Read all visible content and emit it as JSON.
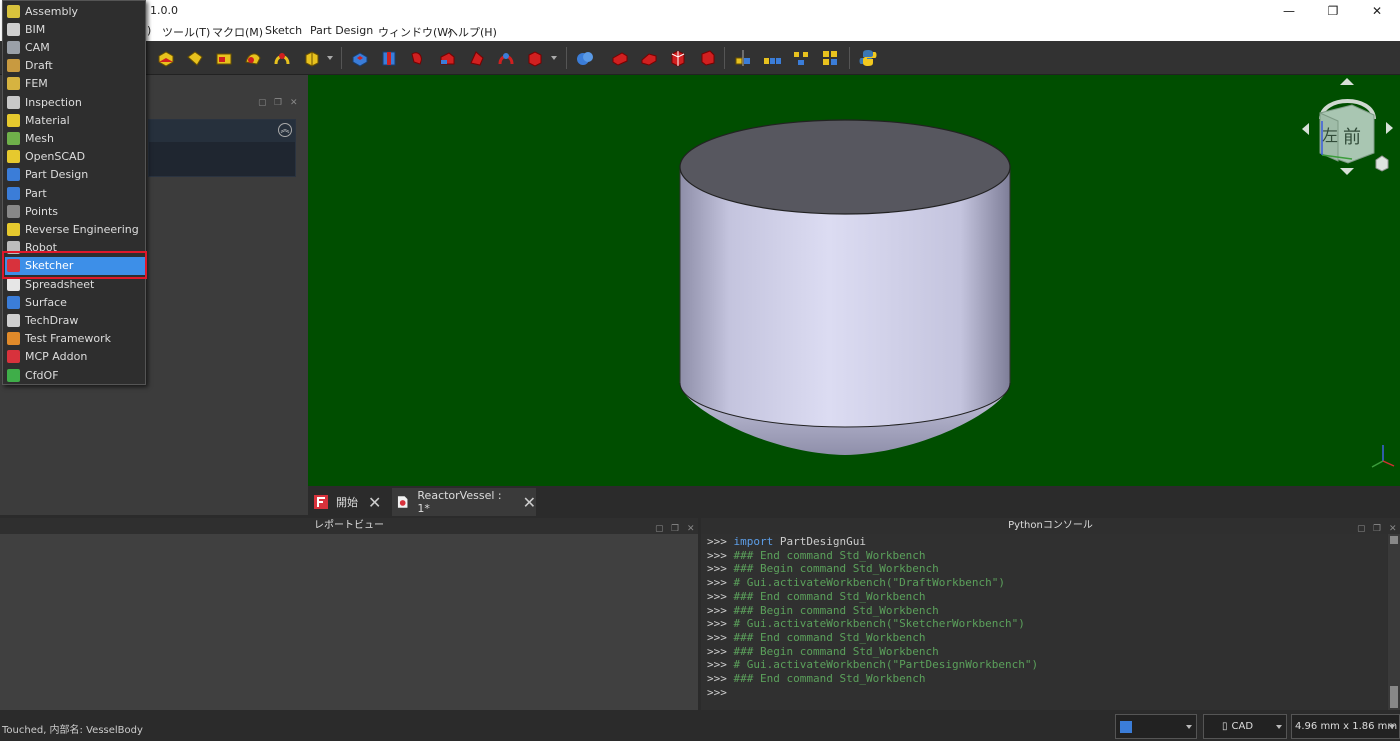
{
  "window": {
    "title": "1.0.0",
    "minimize_glyph": "—",
    "maximize_glyph": "❐",
    "close_glyph": "✕"
  },
  "menubar": {
    "items": [
      "ツール(T)",
      "マクロ(M)",
      "Sketch",
      "Part Design",
      "ウィンドウ(W)",
      "ヘルプ(H)"
    ],
    "fragment": ")"
  },
  "workbench_menu": {
    "items": [
      {
        "label": "Assembly",
        "icon": "assembly-icon",
        "color": "#d8c23c"
      },
      {
        "label": "BIM",
        "icon": "bim-icon",
        "color": "#cfcfcf"
      },
      {
        "label": "CAM",
        "icon": "cam-icon",
        "color": "#9aa0a8"
      },
      {
        "label": "Draft",
        "icon": "draft-icon",
        "color": "#c89a40"
      },
      {
        "label": "FEM",
        "icon": "fem-icon",
        "color": "#d6b340"
      },
      {
        "label": "Inspection",
        "icon": "inspection-icon",
        "color": "#c8c8c8"
      },
      {
        "label": "Material",
        "icon": "material-icon",
        "color": "#e6c92e"
      },
      {
        "label": "Mesh",
        "icon": "mesh-icon",
        "color": "#6fb04a"
      },
      {
        "label": "OpenSCAD",
        "icon": "openscad-icon",
        "color": "#e6c92e"
      },
      {
        "label": "Part Design",
        "icon": "part-design-icon",
        "color": "#3b7dd8"
      },
      {
        "label": "Part",
        "icon": "part-icon",
        "color": "#3b7dd8"
      },
      {
        "label": "Points",
        "icon": "points-icon",
        "color": "#888888"
      },
      {
        "label": "Reverse Engineering",
        "icon": "reverse-engineering-icon",
        "color": "#e6c92e"
      },
      {
        "label": "Robot",
        "icon": "robot-icon",
        "color": "#bdbdbd"
      },
      {
        "label": "Sketcher",
        "icon": "sketcher-icon",
        "color": "#d8323c",
        "selected": true
      },
      {
        "label": "Spreadsheet",
        "icon": "spreadsheet-icon",
        "color": "#e6e6e6"
      },
      {
        "label": "Surface",
        "icon": "surface-icon",
        "color": "#3b7dd8"
      },
      {
        "label": "TechDraw",
        "icon": "techdraw-icon",
        "color": "#cfcfcf"
      },
      {
        "label": "Test Framework",
        "icon": "test-framework-icon",
        "color": "#e08a2a"
      },
      {
        "label": "MCP Addon",
        "icon": "mcp-addon-icon",
        "color": "#d8323c"
      },
      {
        "label": "CfdOF",
        "icon": "cfdof-icon",
        "color": "#3fae49"
      }
    ]
  },
  "document_tabs": [
    {
      "label": "開始",
      "icon": "freecad-start-icon",
      "active": false
    },
    {
      "label": "ReactorVessel : 1*",
      "icon": "document-icon",
      "active": true
    }
  ],
  "report_view": {
    "title": "レポートビュー"
  },
  "python_console": {
    "title": "Pythonコンソール",
    "lines": [
      {
        "prompt": ">>> ",
        "kind": "import",
        "kw": "import",
        "text": " PartDesignGui"
      },
      {
        "prompt": ">>> ",
        "kind": "cmt",
        "text": "### End command Std_Workbench"
      },
      {
        "prompt": ">>> ",
        "kind": "cmt",
        "text": "### Begin command Std_Workbench"
      },
      {
        "prompt": ">>> ",
        "kind": "cmt",
        "text": "# Gui.activateWorkbench(\"DraftWorkbench\")"
      },
      {
        "prompt": ">>> ",
        "kind": "cmt",
        "text": "### End command Std_Workbench"
      },
      {
        "prompt": ">>> ",
        "kind": "cmt",
        "text": "### Begin command Std_Workbench"
      },
      {
        "prompt": ">>> ",
        "kind": "cmt",
        "text": "# Gui.activateWorkbench(\"SketcherWorkbench\")"
      },
      {
        "prompt": ">>> ",
        "kind": "cmt",
        "text": "### End command Std_Workbench"
      },
      {
        "prompt": ">>> ",
        "kind": "cmt",
        "text": "### Begin command Std_Workbench"
      },
      {
        "prompt": ">>> ",
        "kind": "cmt",
        "text": "# Gui.activateWorkbench(\"PartDesignWorkbench\")"
      },
      {
        "prompt": ">>> ",
        "kind": "cmt",
        "text": "### End command Std_Workbench"
      },
      {
        "prompt": ">>> ",
        "kind": "cmt",
        "text": ""
      }
    ]
  },
  "navcube": {
    "left_label": "左",
    "front_label": "前"
  },
  "statusbar": {
    "message": "Touched, 内部名: VesselBody",
    "nav_style": "CAD",
    "dimensions": "4.96 mm x 1.86 mm"
  },
  "colors": {
    "viewport_bg": "#004e00",
    "highlight": "#e0182a",
    "selection": "#3d8fe8"
  }
}
